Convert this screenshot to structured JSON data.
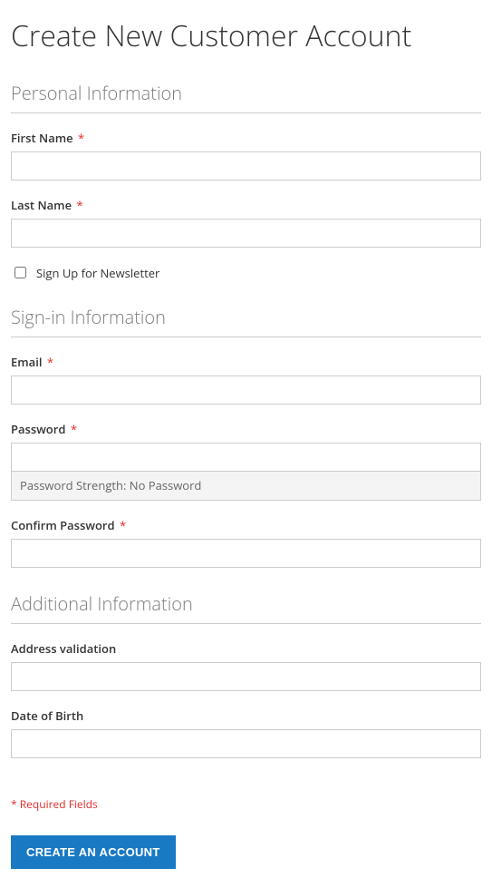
{
  "page_title": "Create New Customer Account",
  "sections": {
    "personal": {
      "legend": "Personal Information"
    },
    "signin": {
      "legend": "Sign-in Information"
    },
    "additional": {
      "legend": "Additional Information"
    }
  },
  "fields": {
    "first_name": {
      "label": "First Name",
      "required": true
    },
    "last_name": {
      "label": "Last Name",
      "required": true
    },
    "newsletter": {
      "label": "Sign Up for Newsletter",
      "checked": false
    },
    "email": {
      "label": "Email",
      "required": true
    },
    "password": {
      "label": "Password",
      "required": true
    },
    "confirm_password": {
      "label": "Confirm Password",
      "required": true
    },
    "address_validation": {
      "label": "Address validation",
      "required": false
    },
    "dob": {
      "label": "Date of Birth",
      "required": false
    }
  },
  "password_strength": {
    "prefix": "Password Strength: ",
    "value": "No Password"
  },
  "required_note": "* Required Fields",
  "submit_label": "Create an Account",
  "required_marker": "*"
}
